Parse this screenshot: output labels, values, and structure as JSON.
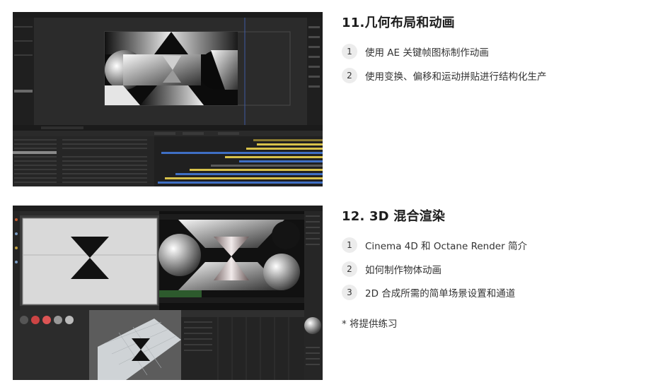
{
  "section1": {
    "title": "11.几何布局和动画",
    "items": [
      {
        "num": "1",
        "text": "使用 AE 关键帧图标制作动画"
      },
      {
        "num": "2",
        "text": "使用变换、偏移和运动拼贴进行结构化生产"
      }
    ]
  },
  "section2": {
    "title": "12. 3D 混合渲染",
    "items": [
      {
        "num": "1",
        "text": "Cinema 4D 和 Octane Render 简介"
      },
      {
        "num": "2",
        "text": "如何制作物体动画"
      },
      {
        "num": "3",
        "text": "2D 合成所需的简单场景设置和通道"
      }
    ]
  },
  "note": "* 将提供练习",
  "colors": {
    "ui_bg": "#232323",
    "panel": "#2e2e2e",
    "timeline_yellow": "#d8c24a",
    "timeline_blue": "#3f6fc4",
    "badge_bg": "#ececec"
  }
}
